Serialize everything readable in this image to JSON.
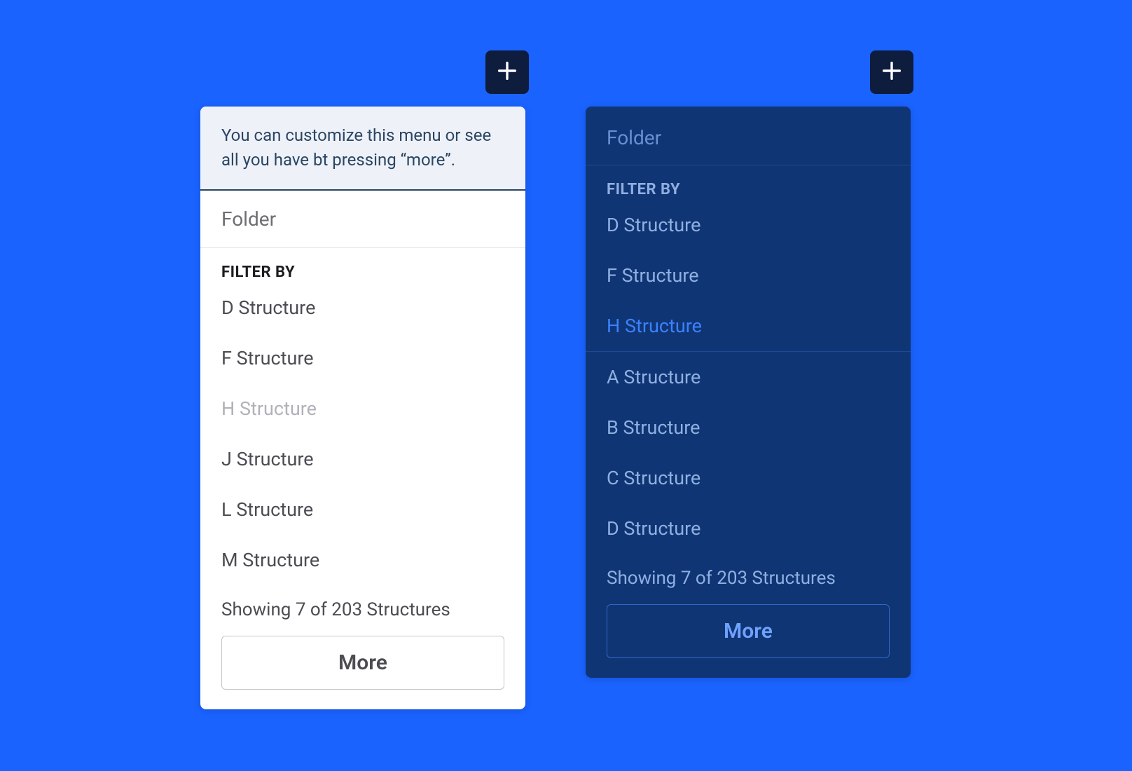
{
  "plusIcon": "plus",
  "light": {
    "banner": "You can customize this menu or see all you have bt pressing “more”.",
    "folder": "Folder",
    "filterLabel": "FILTER BY",
    "items": [
      {
        "label": "D Structure",
        "state": "normal"
      },
      {
        "label": "F Structure",
        "state": "normal"
      },
      {
        "label": "H Structure",
        "state": "disabled"
      },
      {
        "label": "J Structure",
        "state": "normal"
      },
      {
        "label": "L Structure",
        "state": "normal"
      },
      {
        "label": "M Structure",
        "state": "normal"
      }
    ],
    "showing": "Showing 7 of 203 Structures",
    "more": "More"
  },
  "dark": {
    "folder": "Folder",
    "filterLabel": "FILTER BY",
    "items": [
      {
        "label": "D Structure",
        "state": "normal"
      },
      {
        "label": "F Structure",
        "state": "normal"
      },
      {
        "label": "H Structure",
        "state": "highlight"
      },
      {
        "label": "A Structure",
        "state": "normal"
      },
      {
        "label": "B Structure",
        "state": "normal"
      },
      {
        "label": "C Structure",
        "state": "normal"
      },
      {
        "label": "D Structure",
        "state": "normal"
      }
    ],
    "showing": "Showing 7 of 203 Structures",
    "more": "More"
  }
}
